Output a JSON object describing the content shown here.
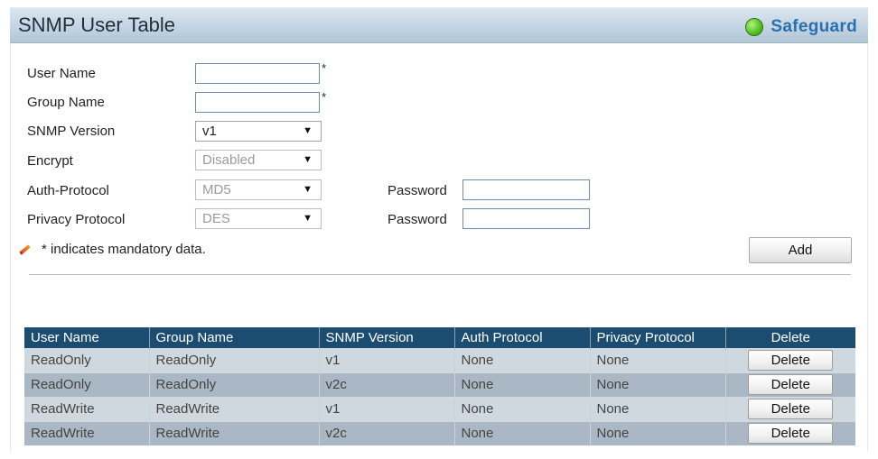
{
  "header": {
    "title": "SNMP User Table",
    "safeguard_label": "Safeguard"
  },
  "form": {
    "user_name_label": "User Name",
    "user_name_value": "",
    "group_name_label": "Group Name",
    "group_name_value": "",
    "mandatory_marker": "*",
    "snmp_version_label": "SNMP Version",
    "snmp_version_value": "v1",
    "encrypt_label": "Encrypt",
    "encrypt_value": "Disabled",
    "auth_protocol_label": "Auth-Protocol",
    "auth_protocol_value": "MD5",
    "auth_password_label": "Password",
    "auth_password_value": "",
    "privacy_protocol_label": "Privacy Protocol",
    "privacy_protocol_value": "DES",
    "privacy_password_label": "Password",
    "privacy_password_value": "",
    "mandatory_note": "* indicates mandatory data.",
    "add_label": "Add",
    "dropdown_arrow": "▼"
  },
  "table": {
    "headers": [
      "User Name",
      "Group Name",
      "SNMP Version",
      "Auth Protocol",
      "Privacy Protocol",
      "Delete"
    ],
    "rows": [
      {
        "user_name": "ReadOnly",
        "group_name": "ReadOnly",
        "snmp_version": "v1",
        "auth_protocol": "None",
        "privacy_protocol": "None",
        "delete_label": "Delete"
      },
      {
        "user_name": "ReadOnly",
        "group_name": "ReadOnly",
        "snmp_version": "v2c",
        "auth_protocol": "None",
        "privacy_protocol": "None",
        "delete_label": "Delete"
      },
      {
        "user_name": "ReadWrite",
        "group_name": "ReadWrite",
        "snmp_version": "v1",
        "auth_protocol": "None",
        "privacy_protocol": "None",
        "delete_label": "Delete"
      },
      {
        "user_name": "ReadWrite",
        "group_name": "ReadWrite",
        "snmp_version": "v2c",
        "auth_protocol": "None",
        "privacy_protocol": "None",
        "delete_label": "Delete"
      }
    ]
  },
  "colors": {
    "table_header": "#1c4d70",
    "row_light": "#cfd8de",
    "row_dark": "#a9b8c4",
    "safeguard_green": "#59c229",
    "safeguard_text": "#2a6fb0"
  },
  "icons": {
    "safeguard": "green-status-dot-icon",
    "note": "pencil-icon"
  }
}
